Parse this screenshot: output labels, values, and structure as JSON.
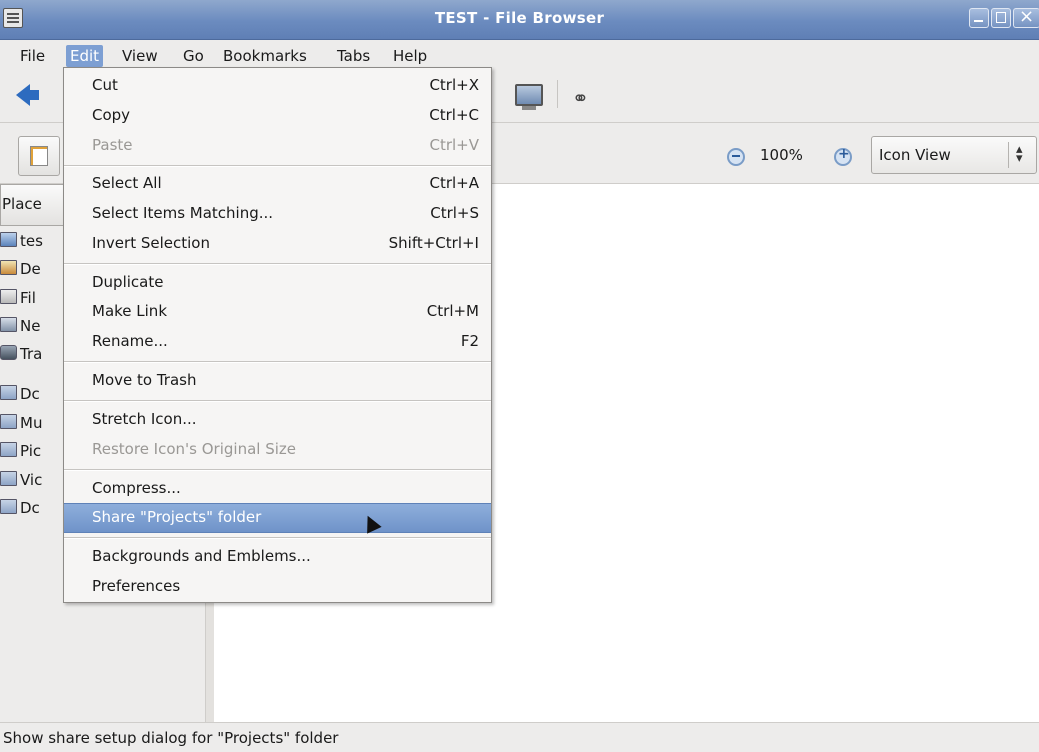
{
  "window": {
    "title": "TEST - File Browser"
  },
  "menubar": {
    "items": [
      {
        "label": "File"
      },
      {
        "label": "Edit"
      },
      {
        "label": "View"
      },
      {
        "label": "Go"
      },
      {
        "label": "Bookmarks"
      },
      {
        "label": "Tabs"
      },
      {
        "label": "Help"
      }
    ]
  },
  "location_bar": {
    "zoom_level": "100%",
    "view_mode": "Icon View"
  },
  "sidebar": {
    "header": "Place",
    "items": [
      {
        "label": "tes",
        "icon": "home-folder-icon"
      },
      {
        "label": "De",
        "icon": "desktop-icon"
      },
      {
        "label": "Fil",
        "icon": "filesystem-icon"
      },
      {
        "label": "Ne",
        "icon": "network-icon"
      },
      {
        "label": "Tra",
        "icon": "trash-icon"
      },
      {
        "label": "Dc",
        "icon": "documents-folder-icon"
      },
      {
        "label": "Mu",
        "icon": "music-folder-icon"
      },
      {
        "label": "Pic",
        "icon": "pictures-folder-icon"
      },
      {
        "label": "Vic",
        "icon": "videos-folder-icon"
      },
      {
        "label": "Dc",
        "icon": "downloads-folder-icon"
      }
    ]
  },
  "edit_menu": {
    "items": [
      {
        "label": "Cut",
        "shortcut": "Ctrl+X",
        "enabled": true
      },
      {
        "label": "Copy",
        "shortcut": "Ctrl+C",
        "enabled": true
      },
      {
        "label": "Paste",
        "shortcut": "Ctrl+V",
        "enabled": false
      },
      {
        "label": "Select All",
        "shortcut": "Ctrl+A",
        "enabled": true
      },
      {
        "label": "Select Items Matching...",
        "shortcut": "Ctrl+S",
        "enabled": true
      },
      {
        "label": "Invert Selection",
        "shortcut": "Shift+Ctrl+I",
        "enabled": true
      },
      {
        "label": "Duplicate",
        "shortcut": "",
        "enabled": true
      },
      {
        "label": "Make Link",
        "shortcut": "Ctrl+M",
        "enabled": true
      },
      {
        "label": "Rename...",
        "shortcut": "F2",
        "enabled": true
      },
      {
        "label": "Move to Trash",
        "shortcut": "",
        "enabled": true
      },
      {
        "label": "Stretch Icon...",
        "shortcut": "",
        "enabled": true
      },
      {
        "label": "Restore Icon's Original Size",
        "shortcut": "",
        "enabled": false
      },
      {
        "label": "Compress...",
        "shortcut": "",
        "enabled": true
      },
      {
        "label": "Share \"Projects\" folder",
        "shortcut": "",
        "enabled": true,
        "highlighted": true
      },
      {
        "label": "Backgrounds and Emblems...",
        "shortcut": "",
        "enabled": true
      },
      {
        "label": "Preferences",
        "shortcut": "",
        "enabled": true
      }
    ]
  },
  "statusbar": {
    "text": "Show share setup dialog for \"Projects\" folder"
  }
}
